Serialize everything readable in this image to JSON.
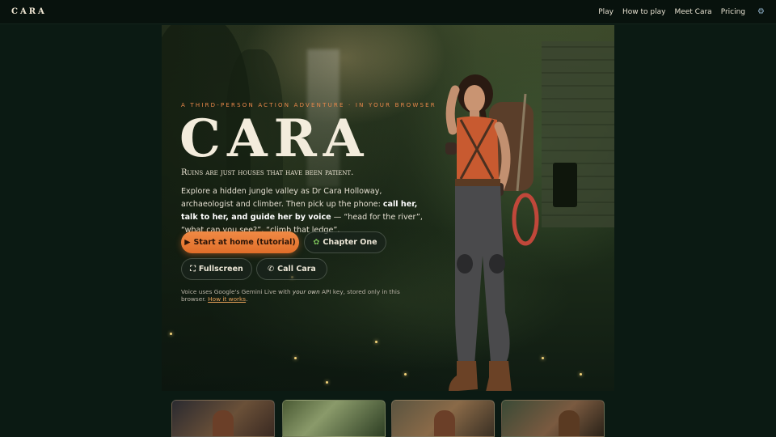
{
  "nav": {
    "brand": "CARA",
    "links": [
      "Play",
      "How to play",
      "Meet Cara",
      "Pricing"
    ],
    "settings_icon": "gear-icon"
  },
  "hero": {
    "kicker": "A THIRD-PERSON ACTION ADVENTURE · IN YOUR BROWSER",
    "title": "CARA",
    "tagline": "Ruins are just houses that have been patient.",
    "description": {
      "part1": "Explore a hidden jungle valley as Dr Cara Holloway, archaeologist and climber. Then pick up the phone: ",
      "bold": "call her, talk to her, and guide her by voice",
      "part2": " — “head for the river”, “what can you see?”, “climb that ledge”."
    },
    "buttons": {
      "start": "Start at home (tutorial)",
      "chapter_one": "Chapter One",
      "fullscreen": "Fullscreen",
      "call": "Call Cara"
    },
    "note": {
      "part1": "Voice uses Google's Gemini Live with ",
      "italic": "your own",
      "part2": " API key, stored only in this browser. ",
      "link": "How it works",
      "end": "."
    }
  },
  "colors": {
    "accent": "#e9884a",
    "background": "#0b1a13",
    "button_primary": "#f08a45"
  }
}
